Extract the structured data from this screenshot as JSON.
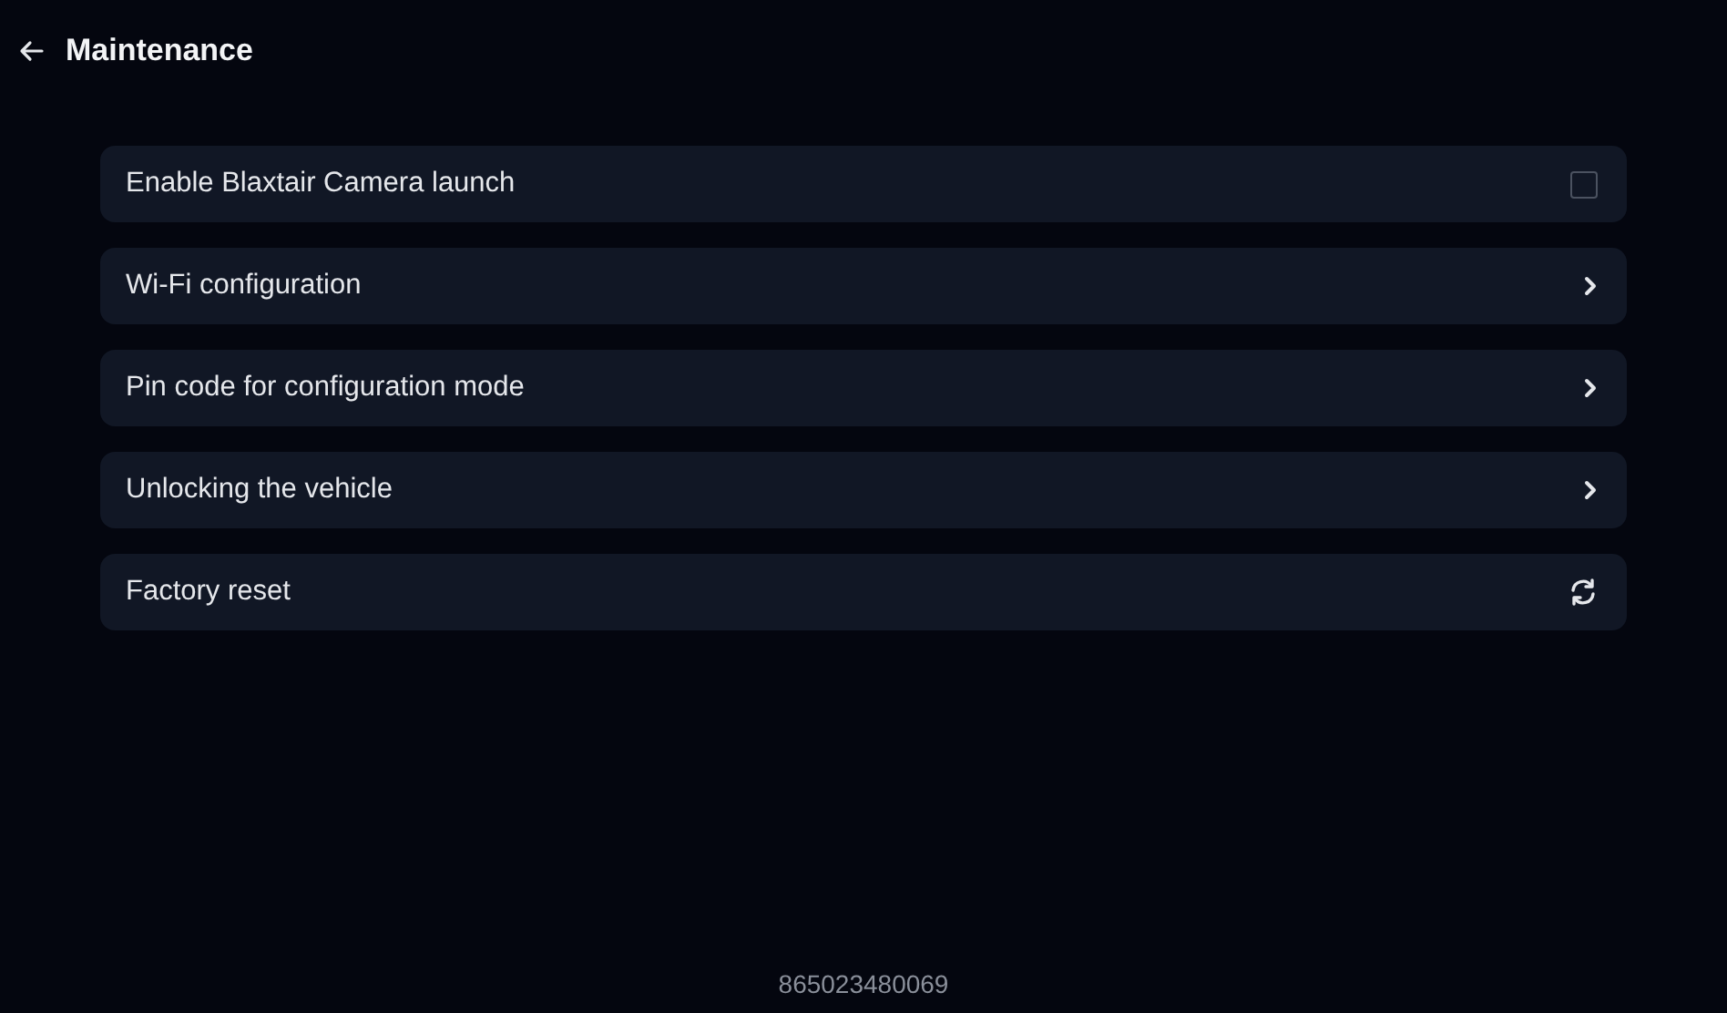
{
  "header": {
    "title": "Maintenance"
  },
  "items": [
    {
      "kind": "checkbox",
      "label": "Enable Blaxtair Camera launch",
      "checked": false
    },
    {
      "kind": "link",
      "label": "Wi-Fi configuration"
    },
    {
      "kind": "link",
      "label": "Pin code for configuration mode"
    },
    {
      "kind": "link",
      "label": "Unlocking the vehicle"
    },
    {
      "kind": "action",
      "label": "Factory reset"
    }
  ],
  "footer": {
    "serial": "865023480069"
  }
}
